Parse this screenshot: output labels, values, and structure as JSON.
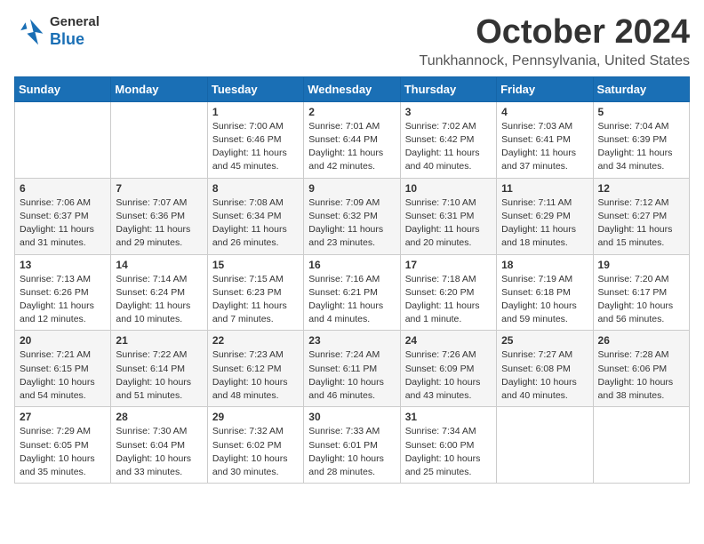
{
  "header": {
    "logo_general": "General",
    "logo_blue": "Blue",
    "month_title": "October 2024",
    "location": "Tunkhannock, Pennsylvania, United States"
  },
  "weekdays": [
    "Sunday",
    "Monday",
    "Tuesday",
    "Wednesday",
    "Thursday",
    "Friday",
    "Saturday"
  ],
  "weeks": [
    [
      {
        "day": "",
        "info": ""
      },
      {
        "day": "",
        "info": ""
      },
      {
        "day": "1",
        "info": "Sunrise: 7:00 AM\nSunset: 6:46 PM\nDaylight: 11 hours and 45 minutes."
      },
      {
        "day": "2",
        "info": "Sunrise: 7:01 AM\nSunset: 6:44 PM\nDaylight: 11 hours and 42 minutes."
      },
      {
        "day": "3",
        "info": "Sunrise: 7:02 AM\nSunset: 6:42 PM\nDaylight: 11 hours and 40 minutes."
      },
      {
        "day": "4",
        "info": "Sunrise: 7:03 AM\nSunset: 6:41 PM\nDaylight: 11 hours and 37 minutes."
      },
      {
        "day": "5",
        "info": "Sunrise: 7:04 AM\nSunset: 6:39 PM\nDaylight: 11 hours and 34 minutes."
      }
    ],
    [
      {
        "day": "6",
        "info": "Sunrise: 7:06 AM\nSunset: 6:37 PM\nDaylight: 11 hours and 31 minutes."
      },
      {
        "day": "7",
        "info": "Sunrise: 7:07 AM\nSunset: 6:36 PM\nDaylight: 11 hours and 29 minutes."
      },
      {
        "day": "8",
        "info": "Sunrise: 7:08 AM\nSunset: 6:34 PM\nDaylight: 11 hours and 26 minutes."
      },
      {
        "day": "9",
        "info": "Sunrise: 7:09 AM\nSunset: 6:32 PM\nDaylight: 11 hours and 23 minutes."
      },
      {
        "day": "10",
        "info": "Sunrise: 7:10 AM\nSunset: 6:31 PM\nDaylight: 11 hours and 20 minutes."
      },
      {
        "day": "11",
        "info": "Sunrise: 7:11 AM\nSunset: 6:29 PM\nDaylight: 11 hours and 18 minutes."
      },
      {
        "day": "12",
        "info": "Sunrise: 7:12 AM\nSunset: 6:27 PM\nDaylight: 11 hours and 15 minutes."
      }
    ],
    [
      {
        "day": "13",
        "info": "Sunrise: 7:13 AM\nSunset: 6:26 PM\nDaylight: 11 hours and 12 minutes."
      },
      {
        "day": "14",
        "info": "Sunrise: 7:14 AM\nSunset: 6:24 PM\nDaylight: 11 hours and 10 minutes."
      },
      {
        "day": "15",
        "info": "Sunrise: 7:15 AM\nSunset: 6:23 PM\nDaylight: 11 hours and 7 minutes."
      },
      {
        "day": "16",
        "info": "Sunrise: 7:16 AM\nSunset: 6:21 PM\nDaylight: 11 hours and 4 minutes."
      },
      {
        "day": "17",
        "info": "Sunrise: 7:18 AM\nSunset: 6:20 PM\nDaylight: 11 hours and 1 minute."
      },
      {
        "day": "18",
        "info": "Sunrise: 7:19 AM\nSunset: 6:18 PM\nDaylight: 10 hours and 59 minutes."
      },
      {
        "day": "19",
        "info": "Sunrise: 7:20 AM\nSunset: 6:17 PM\nDaylight: 10 hours and 56 minutes."
      }
    ],
    [
      {
        "day": "20",
        "info": "Sunrise: 7:21 AM\nSunset: 6:15 PM\nDaylight: 10 hours and 54 minutes."
      },
      {
        "day": "21",
        "info": "Sunrise: 7:22 AM\nSunset: 6:14 PM\nDaylight: 10 hours and 51 minutes."
      },
      {
        "day": "22",
        "info": "Sunrise: 7:23 AM\nSunset: 6:12 PM\nDaylight: 10 hours and 48 minutes."
      },
      {
        "day": "23",
        "info": "Sunrise: 7:24 AM\nSunset: 6:11 PM\nDaylight: 10 hours and 46 minutes."
      },
      {
        "day": "24",
        "info": "Sunrise: 7:26 AM\nSunset: 6:09 PM\nDaylight: 10 hours and 43 minutes."
      },
      {
        "day": "25",
        "info": "Sunrise: 7:27 AM\nSunset: 6:08 PM\nDaylight: 10 hours and 40 minutes."
      },
      {
        "day": "26",
        "info": "Sunrise: 7:28 AM\nSunset: 6:06 PM\nDaylight: 10 hours and 38 minutes."
      }
    ],
    [
      {
        "day": "27",
        "info": "Sunrise: 7:29 AM\nSunset: 6:05 PM\nDaylight: 10 hours and 35 minutes."
      },
      {
        "day": "28",
        "info": "Sunrise: 7:30 AM\nSunset: 6:04 PM\nDaylight: 10 hours and 33 minutes."
      },
      {
        "day": "29",
        "info": "Sunrise: 7:32 AM\nSunset: 6:02 PM\nDaylight: 10 hours and 30 minutes."
      },
      {
        "day": "30",
        "info": "Sunrise: 7:33 AM\nSunset: 6:01 PM\nDaylight: 10 hours and 28 minutes."
      },
      {
        "day": "31",
        "info": "Sunrise: 7:34 AM\nSunset: 6:00 PM\nDaylight: 10 hours and 25 minutes."
      },
      {
        "day": "",
        "info": ""
      },
      {
        "day": "",
        "info": ""
      }
    ]
  ]
}
